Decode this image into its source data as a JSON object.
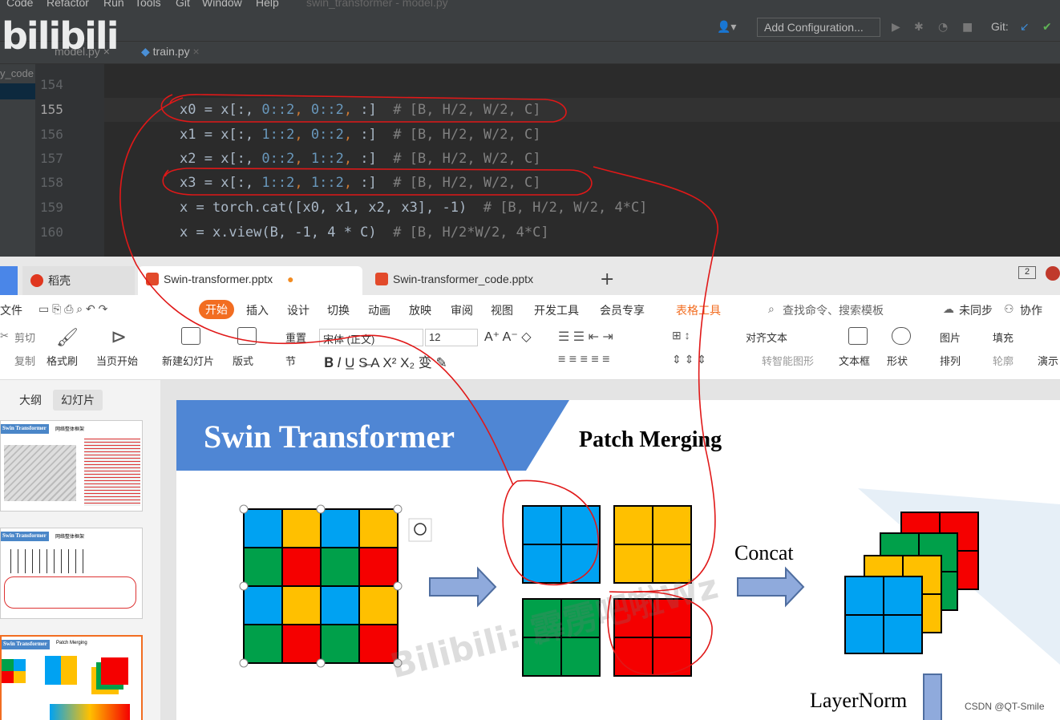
{
  "ide": {
    "menu": [
      "Code",
      "Refactor",
      "Run",
      "Tools",
      "Git",
      "Window",
      "Help"
    ],
    "window_title": "swin_transformer - model.py",
    "add_configuration": "Add Configuration...",
    "git_label": "Git:",
    "tabs": [
      "model.py",
      "train.py"
    ],
    "left_label": "y_code",
    "line_numbers": [
      "154",
      "155",
      "156",
      "157",
      "158",
      "159",
      "160"
    ],
    "code_lines": [
      {
        "var": "x0",
        "a": "0",
        "b": "0",
        "comment": "# [B, H/2, W/2, C]"
      },
      {
        "var": "x1",
        "a": "1",
        "b": "0",
        "comment": "# [B, H/2, W/2, C]"
      },
      {
        "var": "x2",
        "a": "0",
        "b": "1",
        "comment": "# [B, H/2, W/2, C]"
      },
      {
        "var": "x3",
        "a": "1",
        "b": "1",
        "comment": "# [B, H/2, W/2, C]"
      }
    ],
    "cat_line": "x = torch.cat([x0, x1, x2, x3], -1)",
    "cat_comment": "# [B, H/2, W/2, 4*C]",
    "view_line": "x = x.view(B, -1, 4 * C)",
    "view_comment": "# [B, H/2*W/2, 4*C]",
    "logo": "bilibili"
  },
  "wps": {
    "tabs": [
      "稻壳",
      "Swin-transformer.pptx",
      "Swin-transformer_code.pptx"
    ],
    "new_tab": "+",
    "menu": [
      "文件",
      "开始",
      "插入",
      "设计",
      "切换",
      "动画",
      "放映",
      "审阅",
      "视图",
      "开发工具",
      "会员专享",
      "表格工具"
    ],
    "search": "查找命令、搜索模板",
    "sync": "未同步",
    "collab": "协作",
    "ribbon": {
      "cut": "剪切",
      "copy": "复制",
      "format_painter": "格式刷",
      "from_current": "当页开始",
      "new_slide": "新建幻灯片",
      "layout": "版式",
      "section": "节",
      "reset": "重置",
      "font": "宋体 (正文)",
      "size": "12",
      "align_text": "对齐文本",
      "smart_art": "转智能图形",
      "textbox": "文本框",
      "shape": "形状",
      "picture": "图片",
      "fill": "填充",
      "arrange": "排列",
      "outline": "轮廓",
      "present": "演示"
    },
    "panel_tabs": [
      "大纲",
      "幻灯片"
    ],
    "thumbs": [
      {
        "title": "Swin Transformer",
        "sub": "网络整体框架"
      },
      {
        "title": "Swin Transformer",
        "sub": "网络整体框架"
      },
      {
        "title": "Swin Transformer",
        "sub": "Patch Merging"
      }
    ],
    "page_indicator": "2"
  },
  "slide": {
    "title": "Swin Transformer",
    "subtitle": "Patch Merging",
    "concat": "Concat",
    "layernorm": "LayerNorm",
    "watermark": "Bilibili: 霹雳吧啦Wz",
    "colors": {
      "blue": "#00a2f2",
      "yellow": "#ffc000",
      "green": "#00a04a",
      "red": "#f50000",
      "header": "#4f86d4"
    }
  },
  "footer": {
    "csdn": "CSDN @QT-Smile"
  }
}
